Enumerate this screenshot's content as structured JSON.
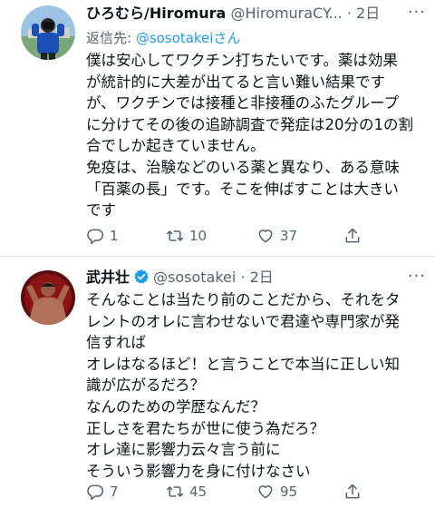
{
  "tweets": [
    {
      "name": "ひろむら/Hiromura",
      "handle": "@HiromuraCY...",
      "time": "2日",
      "reply_label": "返信先:",
      "reply_handle": "@sosotakei",
      "reply_suffix": "さん",
      "body": [
        "僕は安心してワクチン打ちたいです。薬は効果",
        "が統計的に大差が出てると言い難い結果です",
        "が、ワクチンでは接種と非接種のふたグループ",
        "に分けてその後の追跡調査で発症は20分の1の割",
        "合でしか起きていません。",
        "免疫は、治験などのいる薬と異なり、ある意味",
        "「百薬の長」です。そこを伸ばすことは大きい",
        "です"
      ],
      "replies": "1",
      "retweets": "10",
      "likes": "37"
    },
    {
      "name": "武井壮",
      "handle": "@sosotakei",
      "time": "2日",
      "body": [
        "そんなことは当たり前のことだから、それをタ",
        "レントのオレに言わせないで君達や専門家が発",
        "信すれば",
        "オレはなるほど！と言うことで本当に正しい知",
        "識が広がるだろ？",
        "なんのための学歴なんだ？",
        "正しさを君たちが世に使う為だろ？",
        "オレ達に影響力云々言う前に",
        "そういう影響力を身に付けなさい"
      ],
      "replies": "7",
      "retweets": "45",
      "likes": "95"
    }
  ],
  "icons": {
    "reply": "reply-icon",
    "retweet": "retweet-icon",
    "like": "heart-icon",
    "share": "share-icon",
    "verified": "verified-badge-icon",
    "more": "more-icon"
  },
  "colors": {
    "text": "#0f1419",
    "secondary": "#536471",
    "link": "#1d9bf0",
    "verified": "#1d9bf0"
  }
}
